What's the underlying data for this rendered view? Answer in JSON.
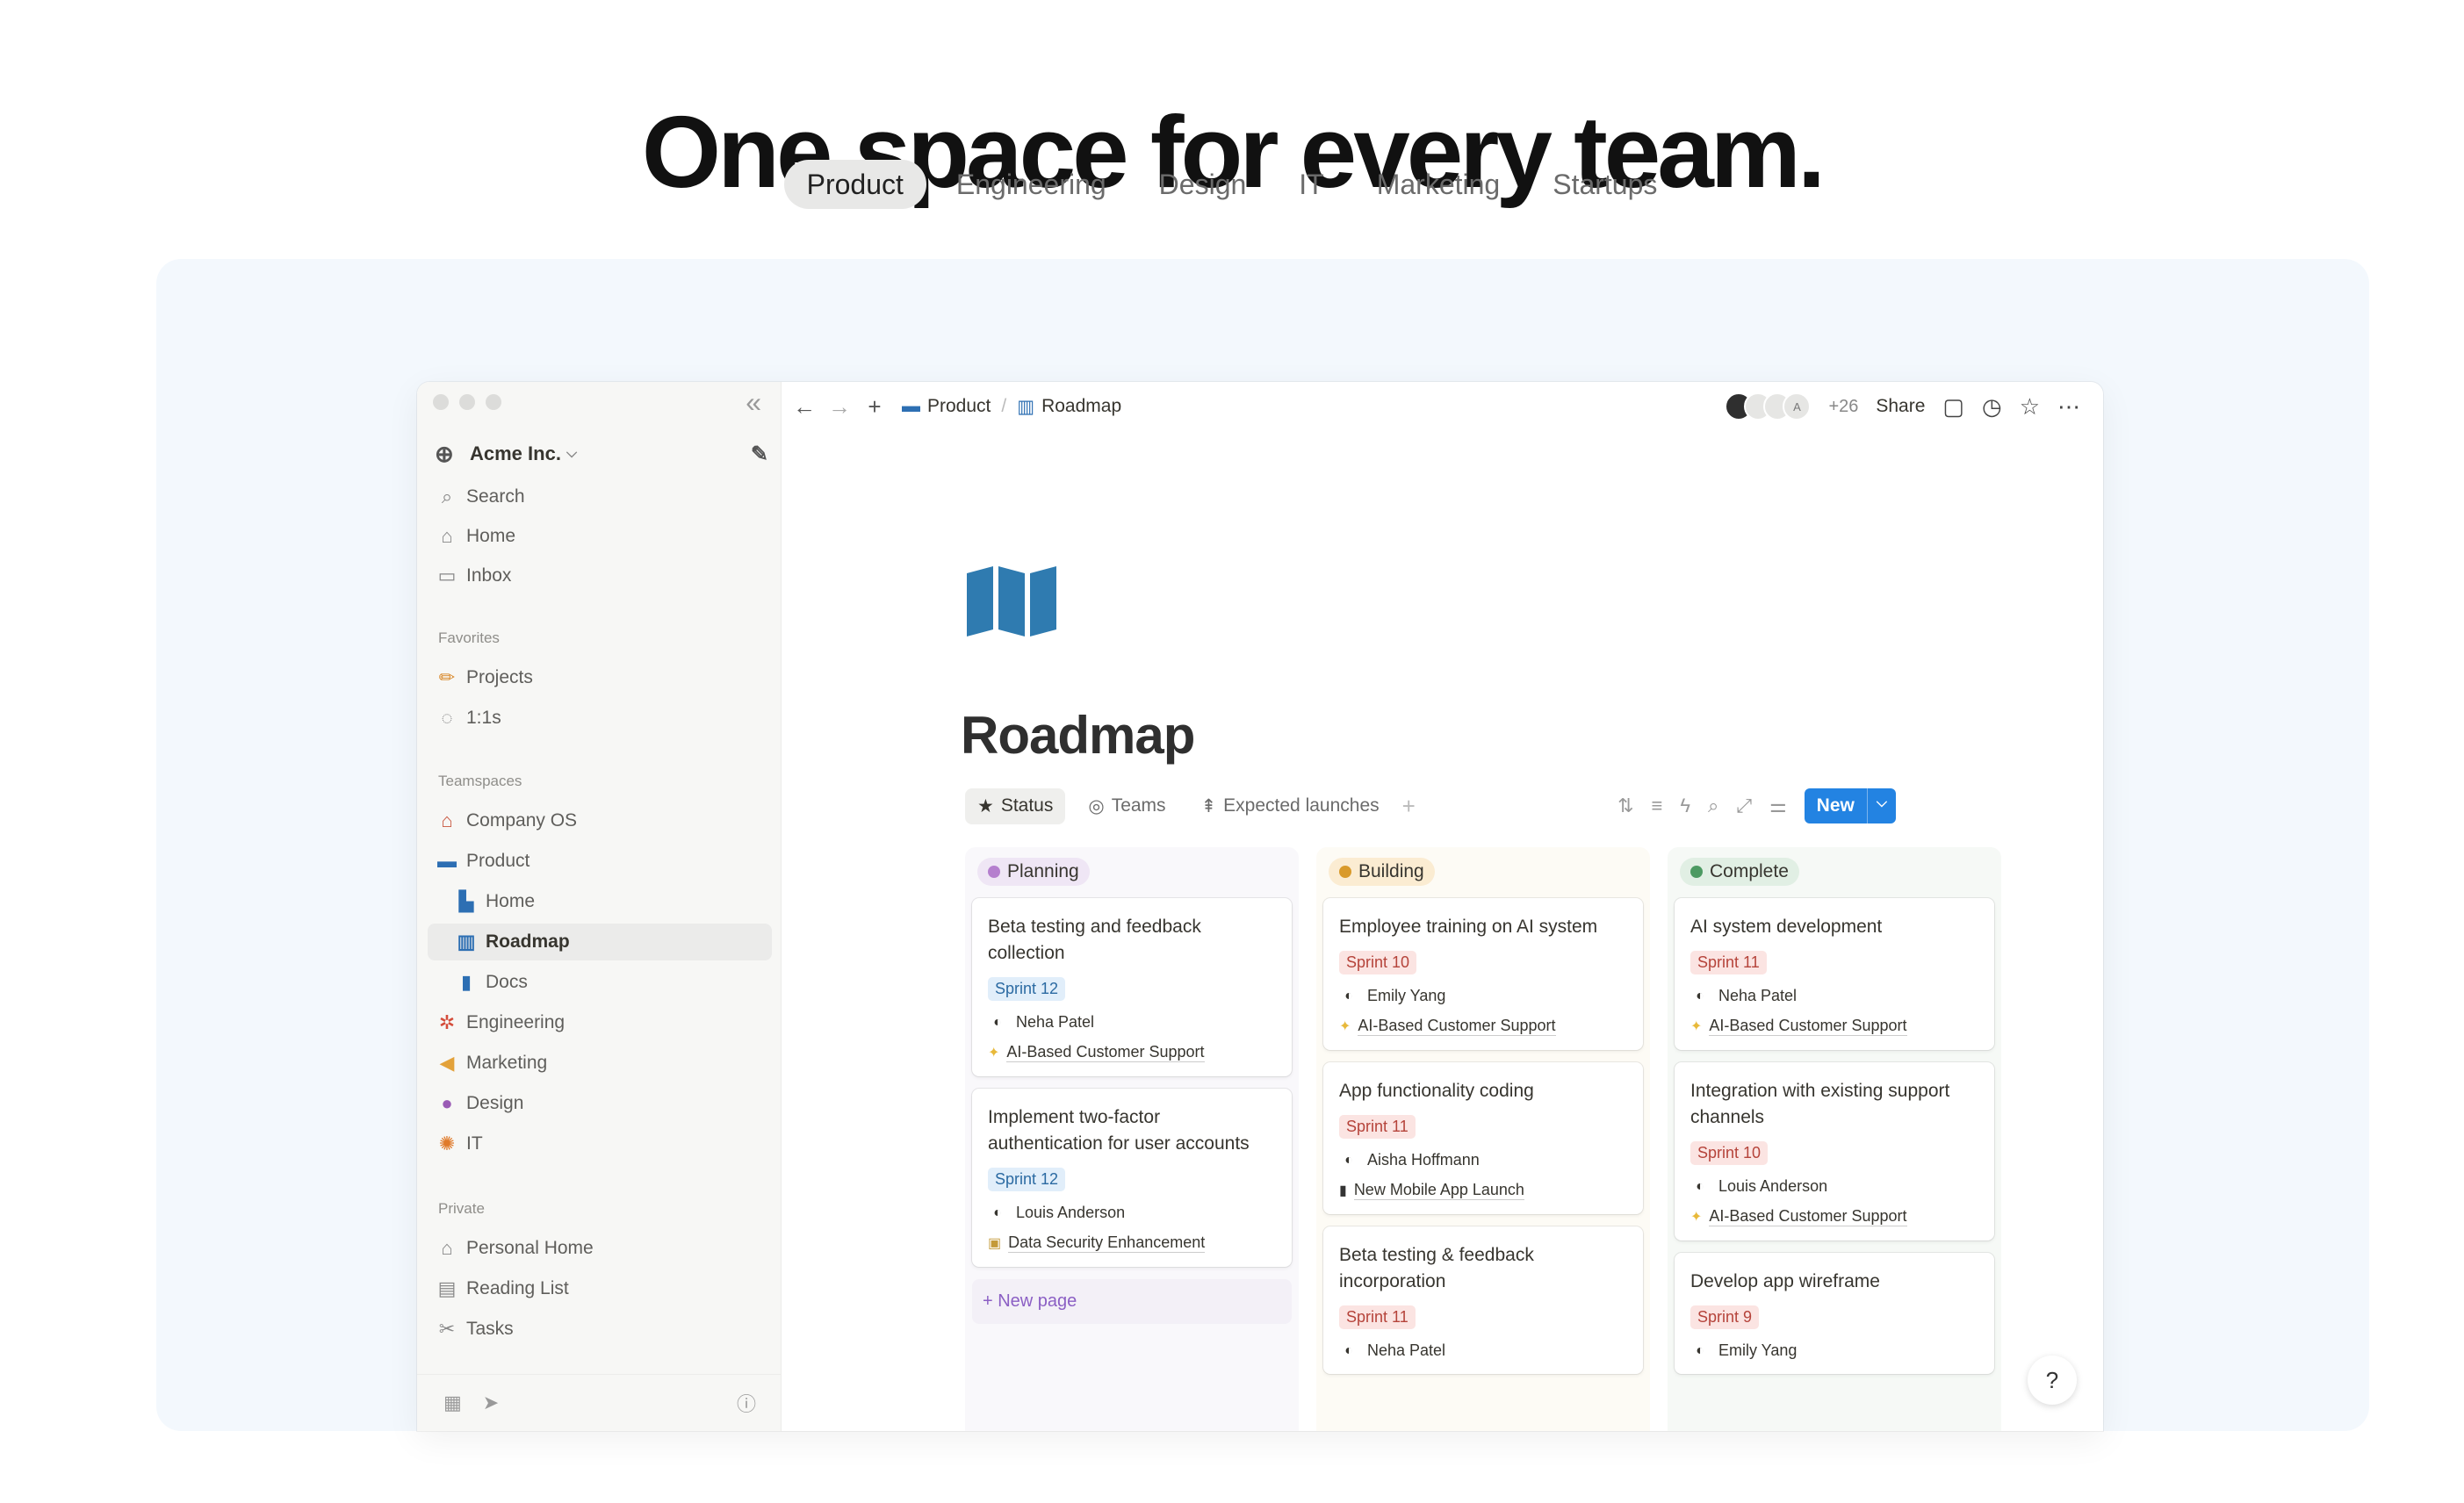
{
  "hero": {
    "title": "One space for every team.",
    "tabs": [
      "Product",
      "Engineering",
      "Design",
      "IT",
      "Marketing",
      "Startups"
    ]
  },
  "sidebar": {
    "workspace": "Acme Inc.",
    "nav": [
      {
        "label": "Search",
        "icon": "search-icon"
      },
      {
        "label": "Home",
        "icon": "home-icon"
      },
      {
        "label": "Inbox",
        "icon": "inbox-icon"
      }
    ],
    "favorites_label": "Favorites",
    "favorites": [
      {
        "label": "Projects",
        "icon": "pencil-icon"
      },
      {
        "label": "1:1s",
        "icon": "chat-icon"
      }
    ],
    "teamspaces_label": "Teamspaces",
    "teamspaces": [
      {
        "label": "Company OS",
        "icon": "house-icon"
      },
      {
        "label": "Product",
        "icon": "laptop-icon"
      },
      {
        "label": "Home",
        "icon": "city-icon"
      },
      {
        "label": "Roadmap",
        "icon": "map-icon"
      },
      {
        "label": "Docs",
        "icon": "bookmark-icon"
      },
      {
        "label": "Engineering",
        "icon": "gear-icon"
      },
      {
        "label": "Marketing",
        "icon": "megaphone-icon"
      },
      {
        "label": "Design",
        "icon": "palette-icon"
      },
      {
        "label": "IT",
        "icon": "bug-icon"
      }
    ],
    "private_label": "Private",
    "private": [
      {
        "label": "Personal Home",
        "icon": "home-icon"
      },
      {
        "label": "Reading List",
        "icon": "book-icon"
      },
      {
        "label": "Tasks",
        "icon": "scissors-icon"
      }
    ]
  },
  "topbar": {
    "breadcrumb": [
      "Product",
      "Roadmap"
    ],
    "avatar_letter": "A",
    "more_count": "+26",
    "share_label": "Share"
  },
  "page": {
    "title": "Roadmap",
    "views": [
      "Status",
      "Teams",
      "Expected launches"
    ],
    "new_label": "New"
  },
  "board": {
    "columns": [
      {
        "name": "Planning",
        "color": "#b57fce",
        "bg": "#efe6f5",
        "cards": [
          {
            "title": "Beta testing and feedback collection",
            "sprint": "Sprint 12",
            "sprint_color": "blue",
            "person": "Neha Patel",
            "project": "AI-Based Customer Support",
            "project_icon": "sparkle-icon"
          },
          {
            "title": "Implement two-factor authentication for user accounts",
            "sprint": "Sprint 12",
            "sprint_color": "blue",
            "person": "Louis Anderson",
            "project": "Data Security Enhancement",
            "project_icon": "lock-icon"
          }
        ],
        "new_page": "+ New page"
      },
      {
        "name": "Building",
        "color": "#d99a2b",
        "bg": "#fbecd2",
        "cards": [
          {
            "title": "Employee training on AI system",
            "sprint": "Sprint 10",
            "sprint_color": "red",
            "person": "Emily Yang",
            "project": "AI-Based Customer Support",
            "project_icon": "sparkle-icon"
          },
          {
            "title": "App functionality coding",
            "sprint": "Sprint 11",
            "sprint_color": "red",
            "person": "Aisha Hoffmann",
            "project": "New Mobile App Launch",
            "project_icon": "phone-icon"
          },
          {
            "title": "Beta testing & feedback incorporation",
            "sprint": "Sprint 11",
            "sprint_color": "red",
            "person": "Neha Patel",
            "project": "",
            "project_icon": ""
          }
        ]
      },
      {
        "name": "Complete",
        "color": "#4c9a62",
        "bg": "#e1efe4",
        "cards": [
          {
            "title": "AI system development",
            "sprint": "Sprint 11",
            "sprint_color": "red",
            "person": "Neha Patel",
            "project": "AI-Based Customer Support",
            "project_icon": "sparkle-icon"
          },
          {
            "title": "Integration with existing support channels",
            "sprint": "Sprint 10",
            "sprint_color": "red",
            "person": "Louis Anderson",
            "project": "AI-Based Customer Support",
            "project_icon": "sparkle-icon"
          },
          {
            "title": "Develop app wireframe",
            "sprint": "Sprint 9",
            "sprint_color": "red",
            "person": "Emily Yang",
            "project": "",
            "project_icon": ""
          }
        ]
      }
    ]
  }
}
